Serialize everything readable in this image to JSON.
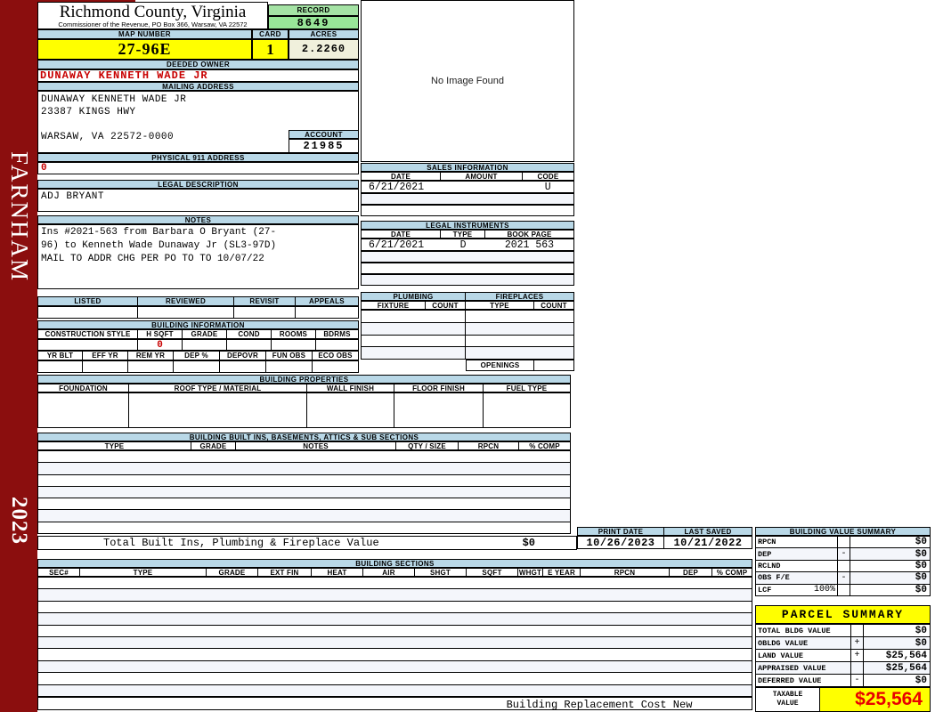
{
  "colors": {
    "header_bar_blue": "#B9D8E7",
    "highlight_yellow": "#FFFF00",
    "record_green": "#9DE59D",
    "acres_cream": "#F0F0DC",
    "sidebar_maroon": "#8B0E0E",
    "alert_red": "#C80000",
    "taxable_red": "#E80000"
  },
  "sidebar": {
    "district": "FARNHAM",
    "year": "2023"
  },
  "header": {
    "county_title": "Richmond County, Virginia",
    "commissioner_line": "Commissioner of the Revenue, PO Box 366, Warsaw, VA 22572",
    "record_label": "RECORD",
    "record_number": "8649",
    "map_number_label": "MAP NUMBER",
    "map_number": "27-96E",
    "card_label": "CARD",
    "card_number": "1",
    "acres_label": "ACRES",
    "acres": "2.2260"
  },
  "owner": {
    "deeded_owner_label": "DEEDED OWNER",
    "deeded_owner": "DUNAWAY KENNETH WADE JR",
    "mailing_address_label": "MAILING ADDRESS",
    "mailing_line1": "DUNAWAY KENNETH WADE JR",
    "mailing_line2": "23387 KINGS HWY",
    "mailing_line3": "WARSAW, VA 22572-0000",
    "account_label": "ACCOUNT",
    "account_number": "21985",
    "physical_911_label": "PHYSICAL 911 ADDRESS",
    "physical_911_value": "0",
    "legal_description_label": "LEGAL DESCRIPTION",
    "legal_description": "ADJ BRYANT",
    "notes_label": "NOTES",
    "notes_line1": "Ins #2021-563 from Barbara O Bryant (27-",
    "notes_line2": "96) to Kenneth Wade Dunaway Jr (SL3-97D)",
    "notes_line3": "MAIL TO ADDR CHG PER PO TO TO 10/07/22"
  },
  "image_box": {
    "message": "No Image Found"
  },
  "review": {
    "headers": [
      "LISTED",
      "REVIEWED",
      "REVISIT",
      "APPEALS"
    ]
  },
  "sales_information": {
    "title": "SALES INFORMATION",
    "headers": [
      "DATE",
      "AMOUNT",
      "CODE"
    ],
    "rows": [
      {
        "date": "6/21/2021",
        "amount": "",
        "code": "U"
      }
    ]
  },
  "legal_instruments": {
    "title": "LEGAL INSTRUMENTS",
    "headers": [
      "DATE",
      "TYPE",
      "BOOK PAGE"
    ],
    "rows": [
      {
        "date": "6/21/2021",
        "type": "D",
        "book_page": "2021 563"
      }
    ]
  },
  "plumbing": {
    "title": "PLUMBING",
    "headers": [
      "FIXTURE",
      "COUNT"
    ]
  },
  "fireplaces": {
    "title": "FIREPLACES",
    "headers": [
      "TYPE",
      "COUNT"
    ],
    "openings_label": "OPENINGS"
  },
  "building_information": {
    "title": "BUILDING INFORMATION",
    "row1_headers": [
      "CONSTRUCTION STYLE",
      "H SQFT",
      "GRADE",
      "COND",
      "ROOMS",
      "BDRMS"
    ],
    "h_sqft_value": "0",
    "row2_headers": [
      "YR BLT",
      "EFF YR",
      "REM YR",
      "DEP %",
      "DEPOVR",
      "FUN OBS",
      "ECO OBS"
    ]
  },
  "building_properties": {
    "title": "BUILDING PROPERTIES",
    "headers": [
      "FOUNDATION",
      "ROOF TYPE / MATERIAL",
      "WALL FINISH",
      "FLOOR FINISH",
      "FUEL TYPE"
    ]
  },
  "built_ins": {
    "title": "BUILDING BUILT INS, BASEMENTS, ATTICS & SUB SECTIONS",
    "headers": [
      "TYPE",
      "GRADE",
      "NOTES",
      "QTY / SIZE",
      "RPCN",
      "% COMP"
    ],
    "total_label": "Total Built Ins, Plumbing & Fireplace Value",
    "total_value": "$0"
  },
  "print_info": {
    "print_date_label": "PRINT DATE",
    "print_date": "10/26/2023",
    "last_saved_label": "LAST SAVED",
    "last_saved": "10/21/2022"
  },
  "building_value_summary": {
    "title": "BUILDING VALUE SUMMARY",
    "rows": [
      {
        "label": "RPCN",
        "pct": "",
        "op": "",
        "value": "$0"
      },
      {
        "label": "DEP",
        "pct": "",
        "op": "-",
        "value": "$0"
      },
      {
        "label": "RCLND",
        "pct": "",
        "op": "",
        "value": "$0"
      },
      {
        "label": "OBS F/E",
        "pct": "",
        "op": "-",
        "value": "$0"
      },
      {
        "label": "LCF",
        "pct": "100%",
        "op": "",
        "value": "$0"
      }
    ]
  },
  "building_sections": {
    "title": "BUILDING SECTIONS",
    "headers": [
      "SEC#",
      "TYPE",
      "GRADE",
      "EXT FIN",
      "HEAT",
      "AIR",
      "SHGT",
      "SQFT",
      "WHGT",
      "E YEAR",
      "RPCN",
      "DEP",
      "% COMP"
    ],
    "footer_label": "Building Replacement Cost New"
  },
  "parcel_summary": {
    "title": "PARCEL SUMMARY",
    "rows": [
      {
        "label": "TOTAL BLDG VALUE",
        "op": "",
        "value": "$0"
      },
      {
        "label": "OBLDG VALUE",
        "op": "+",
        "value": "$0"
      },
      {
        "label": "LAND VALUE",
        "op": "+",
        "value": "$25,564"
      },
      {
        "label": "APPRAISED VALUE",
        "op": "",
        "value": "$25,564"
      },
      {
        "label": "DEFERRED VALUE",
        "op": "-",
        "value": "$0"
      }
    ],
    "taxable_label_line1": "TAXABLE",
    "taxable_label_line2": "VALUE",
    "taxable_value": "$25,564"
  }
}
